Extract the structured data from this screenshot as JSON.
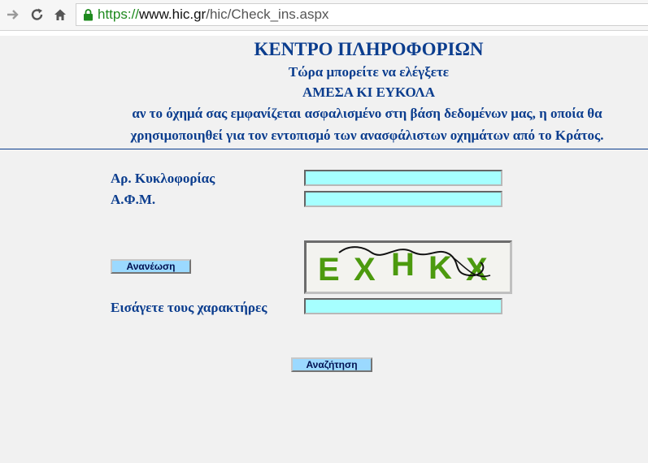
{
  "browser": {
    "url_scheme": "https://",
    "url_host": "www.hic.gr",
    "url_path": "/hic/Check_ins.aspx"
  },
  "header": {
    "title": "ΚΕΝΤΡΟ ΠΛΗΡΟΦΟΡΙΩΝ",
    "line1": "Τώρα μπορείτε να ελέγξετε",
    "line2": "ΑΜΕΣΑ ΚΙ ΕΥΚΟΛΑ",
    "line3": "αν το όχημά σας εμφανίζεται ασφαλισμένο στη βάση δεδομένων μας, η οποία θα",
    "line4": "χρησιμοποιηθεί για τον εντοπισμό των ανασφάλιστων οχημάτων από το Κράτος."
  },
  "form": {
    "plate_label": "Αρ. Κυκλοφορίας",
    "plate_value": "",
    "afm_label": "Α.Φ.Μ.",
    "afm_value": "",
    "refresh_label": "Ανανέωση",
    "captcha_text": "EXHKX",
    "captcha_label": "Εισάγετε τους χαρακτήρες",
    "captcha_value": "",
    "search_label": "Αναζήτηση"
  },
  "colors": {
    "heading": "#0b3d8e",
    "input_bg": "#a6ffff",
    "button_bg": "#9bd9ff",
    "captcha_green": "#4c9a0e"
  }
}
